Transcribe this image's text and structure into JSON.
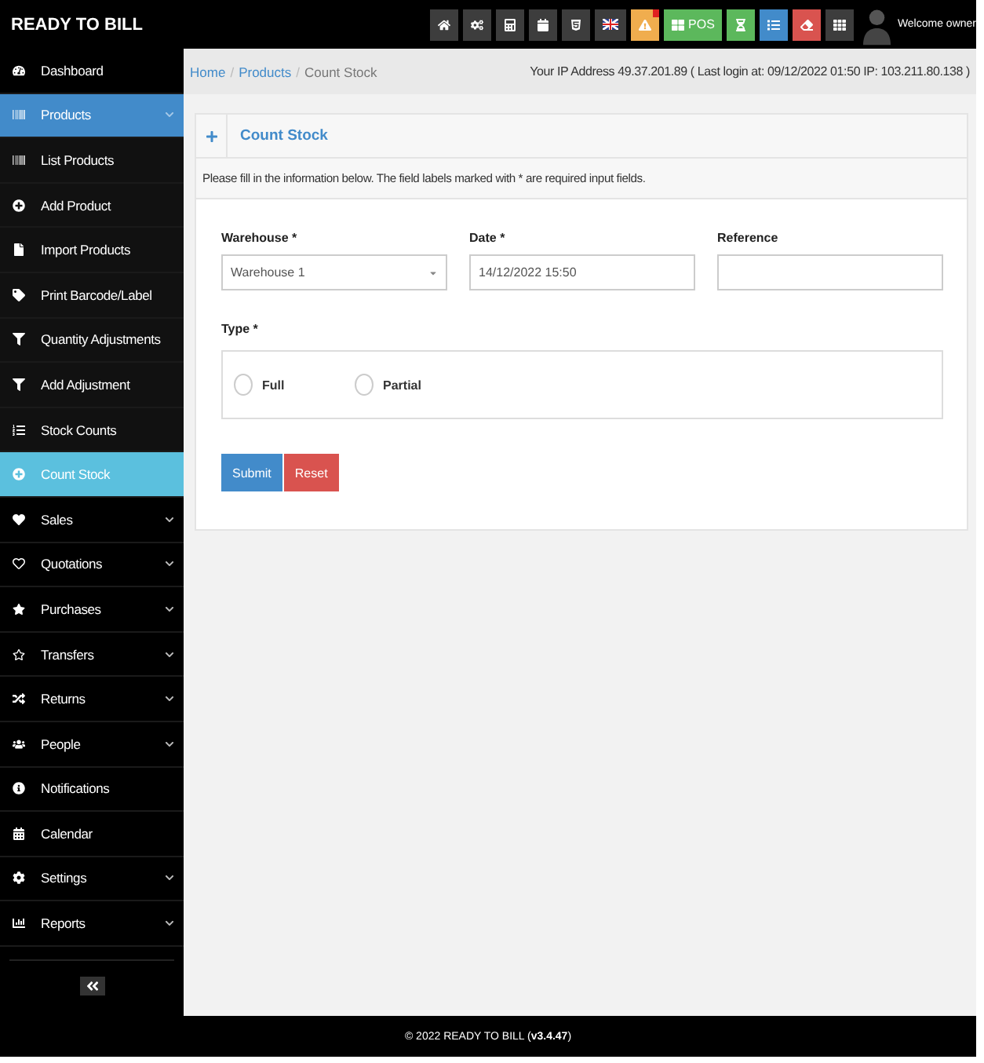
{
  "header": {
    "brand": "READY TO BILL",
    "toolbar": [
      {
        "color": "#3d3d3d"
      },
      {
        "color": "#3d3d3d"
      },
      {
        "color": "#3d3d3d"
      },
      {
        "color": "#3d3d3d"
      },
      {
        "color": "#3d3d3d"
      },
      {
        "color": "#3d3d3d"
      },
      {
        "color": "#f0ad4e",
        "badge": true
      },
      {
        "color": "#5cb85c",
        "label": "POS"
      },
      {
        "color": "#5cb85c"
      },
      {
        "color": "#428bca"
      },
      {
        "color": "#d9534f"
      },
      {
        "color": "#3d3d3d"
      }
    ],
    "user_greeting": "Welcome owner"
  },
  "sidebar": {
    "items": [
      {
        "label": "Dashboard",
        "kind": "link",
        "selected": false
      },
      {
        "label": "Products",
        "kind": "menu",
        "expanded": true,
        "selected": true,
        "children": [
          {
            "label": "List Products",
            "selected": false
          },
          {
            "label": "Add Product",
            "selected": false
          },
          {
            "label": "Import Products",
            "selected": false
          },
          {
            "label": "Print Barcode/Label",
            "selected": false
          },
          {
            "label": "Quantity Adjustments",
            "selected": false
          },
          {
            "label": "Add Adjustment",
            "selected": false
          },
          {
            "label": "Stock Counts",
            "selected": false
          },
          {
            "label": "Count Stock",
            "selected": true
          }
        ]
      },
      {
        "label": "Sales",
        "kind": "menu",
        "expanded": false,
        "selected": false
      },
      {
        "label": "Quotations",
        "kind": "menu",
        "expanded": false,
        "selected": false
      },
      {
        "label": "Purchases",
        "kind": "menu",
        "expanded": false,
        "selected": false
      },
      {
        "label": "Transfers",
        "kind": "menu",
        "expanded": false,
        "selected": false
      },
      {
        "label": "Returns",
        "kind": "menu",
        "expanded": false,
        "selected": false
      },
      {
        "label": "People",
        "kind": "menu",
        "expanded": false,
        "selected": false
      },
      {
        "label": "Notifications",
        "kind": "link",
        "selected": false
      },
      {
        "label": "Calendar",
        "kind": "link",
        "selected": false
      },
      {
        "label": "Settings",
        "kind": "menu",
        "expanded": false,
        "selected": false
      },
      {
        "label": "Reports",
        "kind": "menu",
        "expanded": false,
        "selected": false
      }
    ]
  },
  "breadcrumb_separator": "/",
  "breadcrumb": [
    {
      "label": "Home",
      "kind": "link"
    },
    {
      "label": "Products",
      "kind": "link"
    },
    {
      "label": "Count Stock",
      "kind": "current"
    }
  ],
  "ip_info": "Your IP Address 49.37.201.89 ( Last login at: 09/12/2022 01:50 IP: 103.211.80.138 )",
  "panel": {
    "title": "Count Stock",
    "intro": "Please fill in the information below. The field labels marked with * are required input fields.",
    "fields": [
      {
        "label": "Warehouse *",
        "kind": "select",
        "value": "Warehouse 1"
      },
      {
        "label": "Date *",
        "kind": "text",
        "value": "14/12/2022 15:50"
      },
      {
        "label": "Reference",
        "kind": "text"
      }
    ],
    "type": {
      "label": "Type *",
      "options": [
        {
          "label": "Full",
          "selected": false
        },
        {
          "label": "Partial",
          "selected": false
        }
      ]
    },
    "buttons": [
      {
        "label": "Submit",
        "kind": "primary"
      },
      {
        "label": "Reset",
        "kind": "danger"
      }
    ]
  },
  "footer": "© 2022 READY TO BILL (**v3.4.47**)"
}
